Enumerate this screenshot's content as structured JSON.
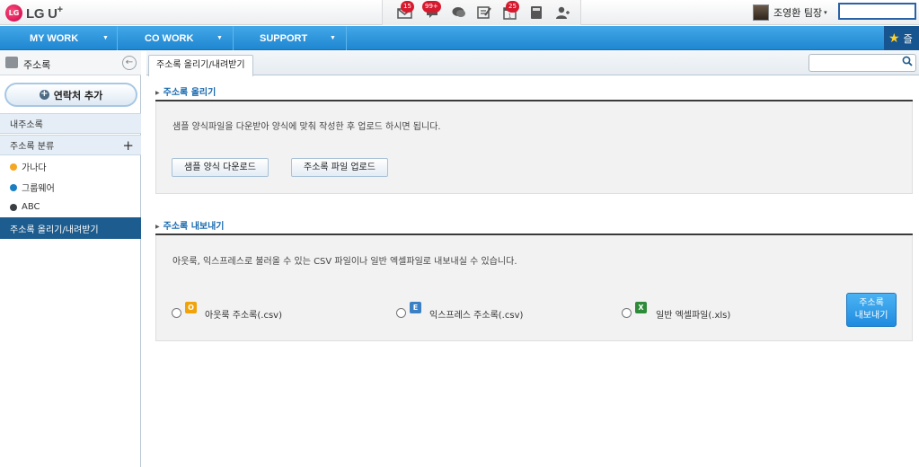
{
  "brand": {
    "logo_mark": "LG",
    "logo_text": "LG U",
    "logo_sup": "+"
  },
  "topbar": {
    "icons": [
      {
        "name": "mail-icon",
        "badge": "15"
      },
      {
        "name": "notification-icon",
        "badge": "99+"
      },
      {
        "name": "chat-icon",
        "badge": ""
      },
      {
        "name": "memo-icon",
        "badge": ""
      },
      {
        "name": "calendar-icon",
        "badge": "25"
      },
      {
        "name": "calculator-icon",
        "badge": ""
      },
      {
        "name": "add-person-icon",
        "badge": ""
      }
    ],
    "user_name": "조영환 팀장",
    "user_caret": "▾"
  },
  "nav": {
    "items": [
      "MY WORK",
      "CO WORK",
      "SUPPORT"
    ],
    "arrow": "▼",
    "right_label": "즐"
  },
  "sidebar": {
    "title": "주소록",
    "back_icon": "←",
    "add_button": "연락처 추가",
    "my_contacts": "내주소록",
    "category_header": "주소록 분류",
    "add_category": "+",
    "categories": [
      {
        "label": "가나다",
        "color": "#f5a623"
      },
      {
        "label": "그룹웨어",
        "color": "#1a7fc2"
      },
      {
        "label": "ABC",
        "color": "#3a3f44"
      }
    ],
    "active_item": "주소록 올리기/내려받기"
  },
  "main": {
    "tab_label": "주소록 올리기/내려받기",
    "search_placeholder": "",
    "upload": {
      "title": "주소록 올리기",
      "description": "샘플 양식파일을 다운받아 양식에 맞춰 작성한 후 업로드 하시면 됩니다.",
      "download_sample": "샘플 양식 다운로드",
      "upload_file": "주소록 파일 업로드"
    },
    "export": {
      "title": "주소록 내보내기",
      "description": "아웃룩, 익스프레스로 불러올 수 있는 CSV 파일이나 일반 엑셀파일로 내보내실 수 있습니다.",
      "options": [
        {
          "label": "아웃룩 주소록(.csv)",
          "icon": "outlook-icon",
          "glyph": "O",
          "color": "#f0a30a"
        },
        {
          "label": "익스프레스 주소록(.csv)",
          "icon": "express-icon",
          "glyph": "E",
          "color": "#3b7fc4"
        },
        {
          "label": "일반 엑셀파일(.xls)",
          "icon": "excel-icon",
          "glyph": "X",
          "color": "#2e8b3a"
        }
      ],
      "button_line1": "주소록",
      "button_line2": "내보내기"
    }
  }
}
